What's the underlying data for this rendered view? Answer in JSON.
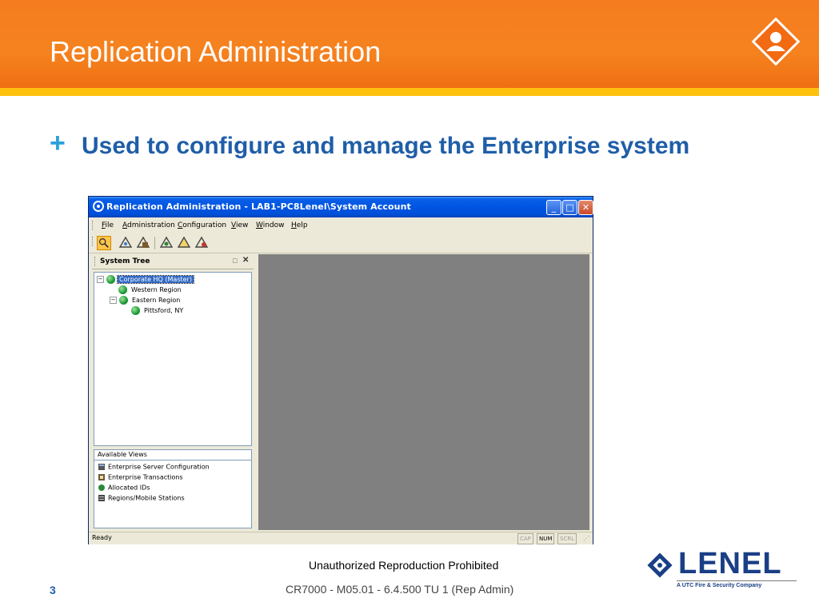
{
  "slide": {
    "title": "Replication Administration",
    "bullet": "Used to configure and manage the Enterprise system",
    "footer_notice": "Unauthorized Reproduction Prohibited",
    "slide_number": "3",
    "course_id": "CR7000 - M05.01 - 6.4.500 TU 1 (Rep Admin)",
    "logo_text": "LENEL",
    "logo_tagline": "A UTC Fire & Security Company",
    "colors": {
      "header_orange": "#f5821f",
      "header_band": "#fdc10e",
      "bullet_blue": "#1f5ea8",
      "plus_blue": "#2aa0dc"
    }
  },
  "app": {
    "window_title": "Replication Administration - LAB1-PC8Lenel\\System Account",
    "title_buttons": {
      "minimize": "_",
      "maximize": "□",
      "close": "✕"
    },
    "menu": [
      "File",
      "Administration",
      "Configuration",
      "View",
      "Window",
      "Help"
    ],
    "toolbar_icons": [
      "system-tree-icon",
      "server-config-icon",
      "transactions-icon",
      "allocated-ids-icon",
      "regions-icon",
      "mobile-stations-icon"
    ],
    "system_tree": {
      "title": "System Tree",
      "pin_label": "□",
      "close_label": "✕",
      "nodes": [
        {
          "label": "Corporate HQ (Master)",
          "selected": true,
          "expander": "−"
        },
        {
          "label": "Western Region"
        },
        {
          "label": "Eastern Region",
          "expander": "−"
        },
        {
          "label": "Pittsford, NY"
        }
      ]
    },
    "available_views": {
      "title": "Available Views",
      "items": [
        "Enterprise Server Configuration",
        "Enterprise Transactions",
        "Allocated IDs",
        "Regions/Mobile Stations"
      ]
    },
    "status": {
      "text": "Ready",
      "indicators": [
        {
          "label": "CAP",
          "on": false
        },
        {
          "label": "NUM",
          "on": true
        },
        {
          "label": "SCRL",
          "on": false
        }
      ]
    }
  }
}
